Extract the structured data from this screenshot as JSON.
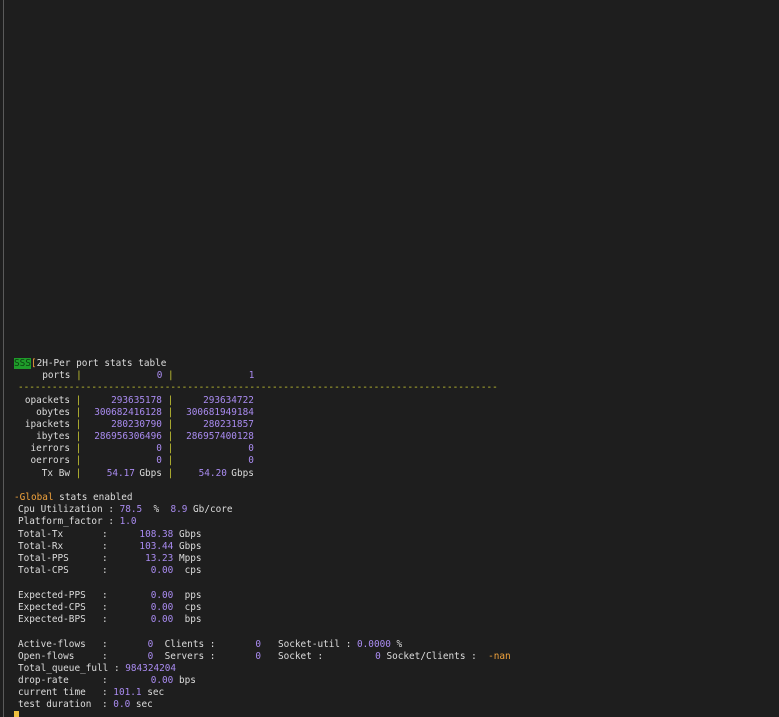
{
  "header": {
    "badge": "SSS",
    "bracket": "[",
    "title": "2H-Per port stats table"
  },
  "ports_table": {
    "ports_label": "ports",
    "port0": "0",
    "port1": "1",
    "divider": "-------------------------------------------------------------------------------------",
    "rows": [
      {
        "label": "opackets",
        "v0": "293635178",
        "v1": "293634722",
        "unit": ""
      },
      {
        "label": "obytes",
        "v0": "300682416128",
        "v1": "300681949184",
        "unit": ""
      },
      {
        "label": "ipackets",
        "v0": "280230790",
        "v1": "280231857",
        "unit": ""
      },
      {
        "label": "ibytes",
        "v0": "286956306496",
        "v1": "286957400128",
        "unit": ""
      },
      {
        "label": "ierrors",
        "v0": "0",
        "v1": "0",
        "unit": ""
      },
      {
        "label": "oerrors",
        "v0": "0",
        "v1": "0",
        "unit": ""
      },
      {
        "label": "Tx Bw",
        "v0": "54.17",
        "v1": "54.20",
        "unit": "Gbps"
      }
    ]
  },
  "global": {
    "dash": "-",
    "label": "Global",
    "rest": " stats enabled",
    "cpu_label": "Cpu Utilization",
    "cpu_value": "78.5",
    "cpu_pct": "%",
    "cpu_core_value": "8.9",
    "cpu_core_unit": "Gb/core",
    "platform_label": "Platform_factor",
    "platform_value": "1.0",
    "stats": [
      {
        "label": "Total-Tx",
        "value": "108.38",
        "unit": "Gbps"
      },
      {
        "label": "Total-Rx",
        "value": "103.44",
        "unit": "Gbps"
      },
      {
        "label": "Total-PPS",
        "value": "13.23",
        "unit": "Mpps"
      },
      {
        "label": "Total-CPS",
        "value": "0.00",
        "unit": " cps"
      }
    ],
    "expected": [
      {
        "label": "Expected-PPS",
        "value": "0.00",
        "unit": " pps"
      },
      {
        "label": "Expected-CPS",
        "value": "0.00",
        "unit": " cps"
      },
      {
        "label": "Expected-BPS",
        "value": "0.00",
        "unit": " bps"
      }
    ],
    "active_flows_label": "Active-flows",
    "active_flows_value": "0",
    "clients_label": "Clients",
    "clients_value": "0",
    "socket_util_label": "Socket-util",
    "socket_util_value": "0.0000",
    "socket_util_unit": "%",
    "open_flows_label": "Open-flows",
    "open_flows_value": "0",
    "servers_label": "Servers",
    "servers_value": "0",
    "socket_label": "Socket",
    "socket_value": "0",
    "socket_clients_label": "Socket/Clients",
    "socket_clients_value": "-nan",
    "total_queue_label": "Total_queue_full",
    "total_queue_value": "984324204",
    "drop_rate_label": "drop-rate",
    "drop_rate_value": "0.00",
    "drop_rate_unit": " bps",
    "current_time_label": "current time",
    "current_time_value": "101.1",
    "current_time_unit": "sec",
    "test_duration_label": "test duration",
    "test_duration_value": "0.0",
    "test_duration_unit": "sec"
  }
}
